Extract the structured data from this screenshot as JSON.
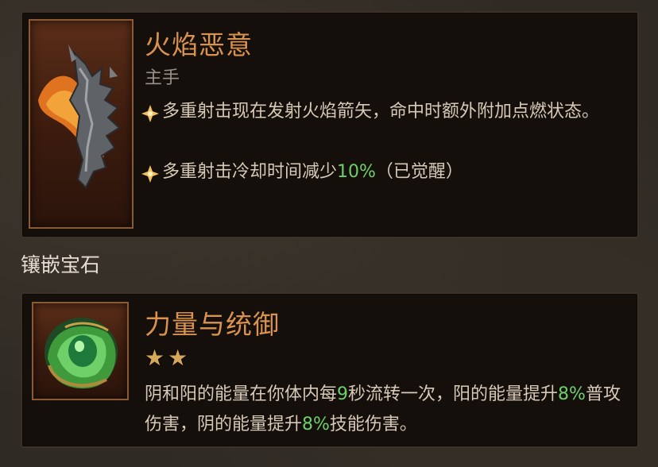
{
  "item": {
    "name": "火焰恶意",
    "slot": "主手",
    "affixes": [
      {
        "text": "多重射击现在发射火焰箭矢，命中时额外附加点燃状态。"
      },
      {
        "before": "多重射击冷却时间减少",
        "highlight": "10%",
        "after": "（已觉醒）"
      }
    ],
    "icon": "flame-weapon-icon"
  },
  "gems_section": {
    "label": "镶嵌宝石"
  },
  "gem": {
    "name": "力量与统御",
    "stars": 2,
    "star_glyphs": [
      "★",
      "★"
    ],
    "desc_parts": [
      {
        "t": "阴和阳的能量在你体内每"
      },
      {
        "t": "9",
        "g": true
      },
      {
        "t": "秒流转一次，阳的能量提升"
      },
      {
        "t": "8%",
        "g": true
      },
      {
        "t": "普攻伤害，阴的能量提升"
      },
      {
        "t": "8%",
        "g": true
      },
      {
        "t": "技能伤害。"
      }
    ],
    "icon": "green-helmet-gem-icon"
  },
  "colors": {
    "title": "#d9934f",
    "green": "#6ecf6a",
    "text": "#d7c9b8"
  }
}
